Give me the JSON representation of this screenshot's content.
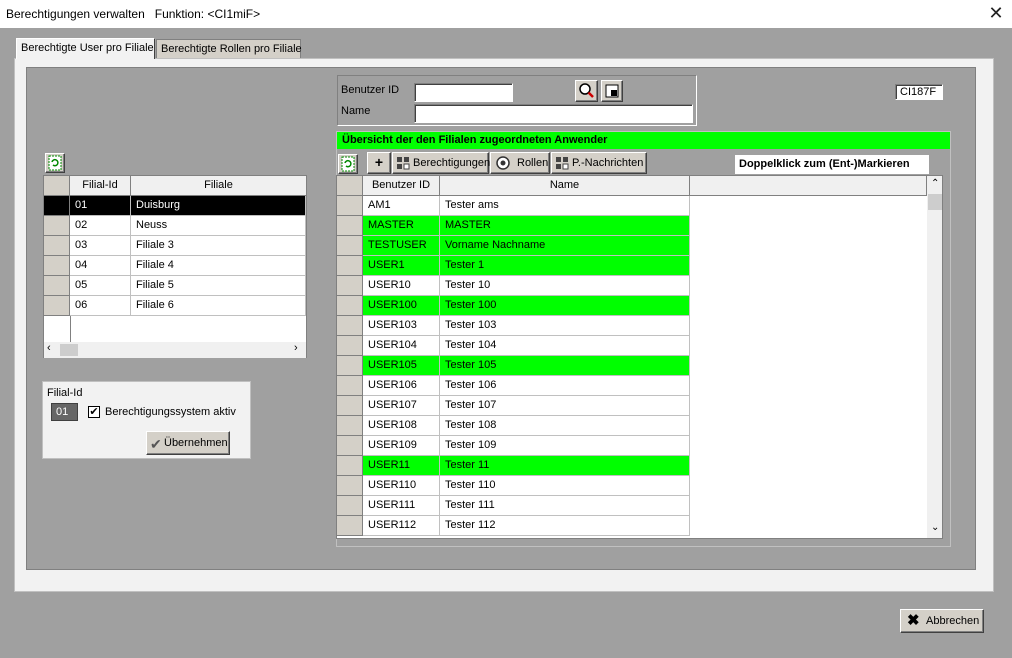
{
  "window": {
    "title": "Berechtigungen verwalten   Funktion: <CI1miF>"
  },
  "tabs": [
    {
      "label": "Berechtigte User pro Filiale",
      "active": true
    },
    {
      "label": "Berechtigte Rollen pro Filiale",
      "active": false
    }
  ],
  "search": {
    "user_id_label": "Benutzer ID",
    "user_id_value": "",
    "name_label": "Name",
    "name_value": ""
  },
  "form_code": "CI187F",
  "branch_grid": {
    "columns": [
      "Filial-Id",
      "Filiale"
    ],
    "rows": [
      {
        "id": "01",
        "name": "Duisburg",
        "selected": true
      },
      {
        "id": "02",
        "name": "Neuss",
        "selected": false
      },
      {
        "id": "03",
        "name": "Filiale 3",
        "selected": false
      },
      {
        "id": "04",
        "name": "Filiale 4",
        "selected": false
      },
      {
        "id": "05",
        "name": "Filiale 5",
        "selected": false
      },
      {
        "id": "06",
        "name": "Filiale 6",
        "selected": false
      }
    ]
  },
  "branch_panel": {
    "label": "Filial-Id",
    "value": "01",
    "checkbox_label": "Berechtigungssystem aktiv",
    "checkbox_checked": true,
    "apply_label": "Übernehmen"
  },
  "users_panel": {
    "header": "Übersicht der den Filialen zugeordneten Anwender",
    "toolbar": {
      "add_label": "+",
      "permissions_label": "Berechtigungen",
      "roles_label": "Rollen",
      "messages_label": "P.-Nachrichten"
    },
    "hint": "Doppelklick zum (Ent-)Markieren",
    "columns": [
      "Benutzer ID",
      "Name"
    ],
    "rows": [
      {
        "id": "AM1",
        "name": "Tester ams",
        "marked": false
      },
      {
        "id": "MASTER",
        "name": "MASTER",
        "marked": true
      },
      {
        "id": "TESTUSER",
        "name": "Vorname Nachname",
        "marked": true
      },
      {
        "id": "USER1",
        "name": "Tester 1",
        "marked": true
      },
      {
        "id": "USER10",
        "name": "Tester 10",
        "marked": false
      },
      {
        "id": "USER100",
        "name": "Tester 100",
        "marked": true
      },
      {
        "id": "USER103",
        "name": "Tester 103",
        "marked": false
      },
      {
        "id": "USER104",
        "name": "Tester 104",
        "marked": false
      },
      {
        "id": "USER105",
        "name": "Tester 105",
        "marked": true
      },
      {
        "id": "USER106",
        "name": "Tester 106",
        "marked": false
      },
      {
        "id": "USER107",
        "name": "Tester 107",
        "marked": false
      },
      {
        "id": "USER108",
        "name": "Tester 108",
        "marked": false
      },
      {
        "id": "USER109",
        "name": "Tester 109",
        "marked": false
      },
      {
        "id": "USER11",
        "name": "Tester 11",
        "marked": true
      },
      {
        "id": "USER110",
        "name": "Tester 110",
        "marked": false
      },
      {
        "id": "USER111",
        "name": "Tester 111",
        "marked": false
      },
      {
        "id": "USER112",
        "name": "Tester 112",
        "marked": false
      }
    ]
  },
  "footer": {
    "cancel_label": "Abbrechen"
  },
  "colors": {
    "marked": "#00ff00",
    "selected": "#000000"
  }
}
